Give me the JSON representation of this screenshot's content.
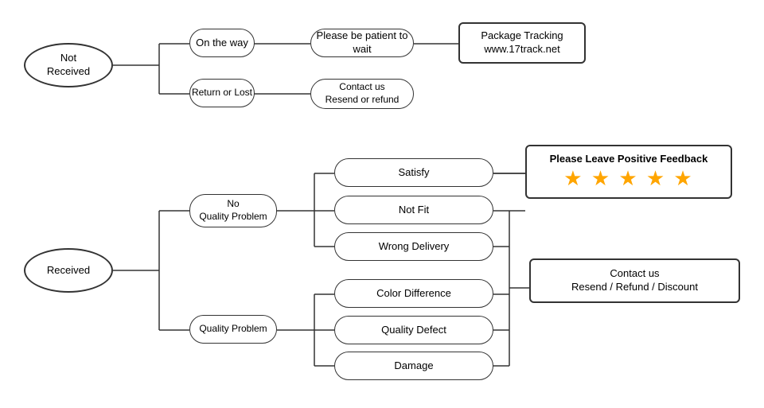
{
  "nodes": {
    "not_received": {
      "label": "Not\nReceived"
    },
    "on_the_way": {
      "label": "On the way"
    },
    "patient": {
      "label": "Please be patient to wait"
    },
    "package_tracking": {
      "label": "Package Tracking\nwww.17track.net"
    },
    "return_lost": {
      "label": "Return or Lost"
    },
    "contact_resend": {
      "label": "Contact us\nResend or refund"
    },
    "received": {
      "label": "Received"
    },
    "no_quality": {
      "label": "No\nQuality Problem"
    },
    "satisfy": {
      "label": "Satisfy"
    },
    "not_fit": {
      "label": "Not Fit"
    },
    "wrong_delivery": {
      "label": "Wrong Delivery"
    },
    "quality_problem": {
      "label": "Quality Problem"
    },
    "color_diff": {
      "label": "Color Difference"
    },
    "quality_defect": {
      "label": "Quality Defect"
    },
    "damage": {
      "label": "Damage"
    },
    "feedback": {
      "label": "Please Leave Positive Feedback"
    },
    "stars": {
      "label": "★ ★ ★ ★ ★"
    },
    "contact_resend2": {
      "label": "Contact us\nResend / Refund / Discount"
    }
  }
}
